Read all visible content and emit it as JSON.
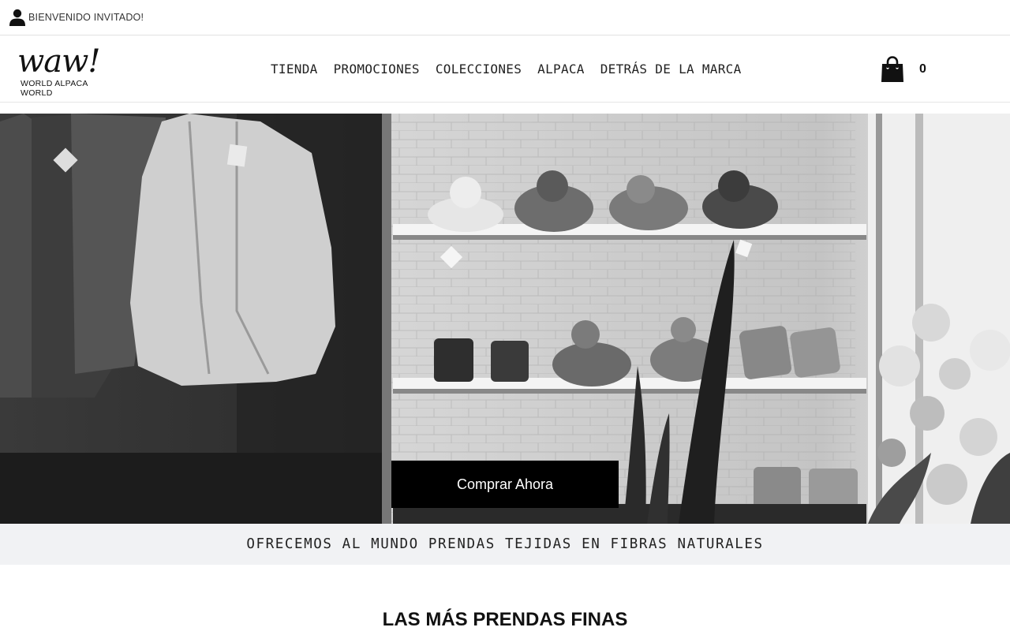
{
  "topbar": {
    "welcome": "BIENVENIDO INVITADO!",
    "icon": "user-icon"
  },
  "header": {
    "logo_mark": "waw!",
    "logo_tagline": "WORLD ALPACA WORLD",
    "nav": [
      "TIENDA",
      "PROMOCIONES",
      "COLECCIONES",
      "ALPACA",
      "DETRÁS DE LA MARCA"
    ],
    "cart_count": "0",
    "cart_icon": "shopping-bag-icon"
  },
  "hero": {
    "cta_label": "Comprar Ahora"
  },
  "band": {
    "text": "OFRECEMOS AL MUNDO PRENDAS TEJIDAS EN FIBRAS NATURALES"
  },
  "section": {
    "title": "LAS MÁS PRENDAS FINAS"
  }
}
